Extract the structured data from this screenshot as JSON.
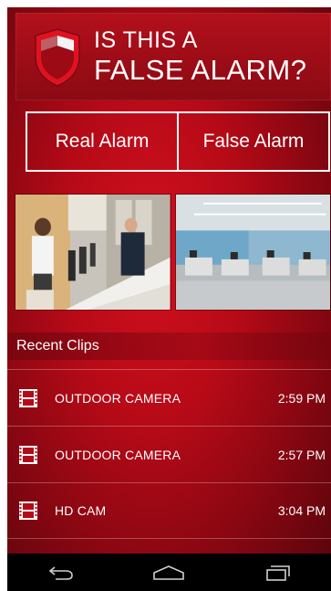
{
  "header": {
    "title_line1": "IS THIS A",
    "title_line2": "FALSE ALARM?",
    "logo_icon": "shield-icon"
  },
  "actions": {
    "real_alarm_label": "Real Alarm",
    "false_alarm_label": "False Alarm"
  },
  "cameras": [
    {
      "icon": "camera-feed-lobby"
    },
    {
      "icon": "camera-feed-office"
    }
  ],
  "recent": {
    "title": "Recent Clips",
    "clips": [
      {
        "name": "OUTDOOR CAMERA",
        "time": "2:59 PM",
        "icon": "film-icon"
      },
      {
        "name": "OUTDOOR CAMERA",
        "time": "2:57 PM",
        "icon": "film-icon"
      },
      {
        "name": "HD CAM",
        "time": "3:04 PM",
        "icon": "film-icon"
      }
    ]
  },
  "navbar": {
    "back_icon": "back-icon",
    "home_icon": "home-icon",
    "recents_icon": "recents-icon"
  },
  "colors": {
    "brand_red": "#c8101e",
    "dark_red": "#6e0510",
    "nav_bg": "#000000"
  }
}
